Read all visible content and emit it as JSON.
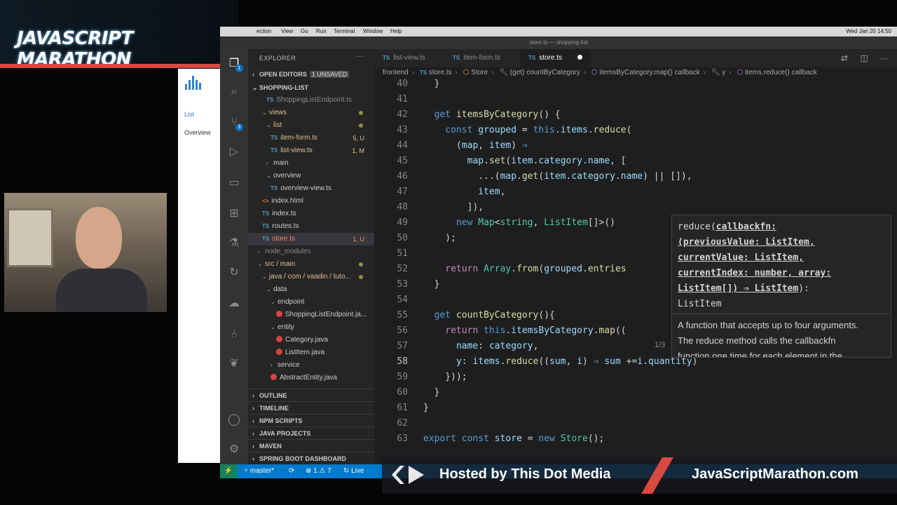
{
  "overlay": {
    "brand_title": "JAVASCRIPT MARATHON",
    "hosted_by": "Hosted by This Dot Media",
    "site_url": "JavaScriptMarathon.com"
  },
  "web_app": {
    "nav": [
      "List",
      "Overview"
    ]
  },
  "menubar": {
    "items": [
      "ection",
      "View",
      "Go",
      "Run",
      "Terminal",
      "Window",
      "Help"
    ],
    "clock": "Wed Jan 20 14:50"
  },
  "window_title": "store.ts — shopping-list",
  "sidebar": {
    "title": "EXPLORER",
    "more": "···",
    "open_editors": "OPEN EDITORS",
    "unsaved_badge": "1 UNSAVED",
    "project": "SHOPPING-LIST",
    "tree": [
      {
        "label": "ShoppingListEndpoint.ts",
        "kind": "ts",
        "status": ""
      },
      {
        "label": "views",
        "kind": "folder",
        "status": ""
      },
      {
        "label": "list",
        "kind": "folder",
        "status": ""
      },
      {
        "label": "item-form.ts",
        "kind": "ts",
        "status": "5, U"
      },
      {
        "label": "list-view.ts",
        "kind": "ts",
        "status": "1, M"
      },
      {
        "label": "main",
        "kind": "folder-closed",
        "status": ""
      },
      {
        "label": "overview",
        "kind": "folder",
        "status": ""
      },
      {
        "label": "overview-view.ts",
        "kind": "ts",
        "status": ""
      },
      {
        "label": "index.html",
        "kind": "html",
        "status": ""
      },
      {
        "label": "index.ts",
        "kind": "ts",
        "status": ""
      },
      {
        "label": "routes.ts",
        "kind": "ts",
        "status": ""
      },
      {
        "label": "store.ts",
        "kind": "ts",
        "status": "1, U"
      },
      {
        "label": "node_modules",
        "kind": "folder-closed",
        "status": ""
      },
      {
        "label": "src / main",
        "kind": "folder",
        "status": ""
      },
      {
        "label": "java / com / vaadin / tuto...",
        "kind": "folder",
        "status": ""
      },
      {
        "label": "data",
        "kind": "folder",
        "status": ""
      },
      {
        "label": "endpoint",
        "kind": "folder",
        "status": ""
      },
      {
        "label": "ShoppingListEndpoint.ja...",
        "kind": "java",
        "status": ""
      },
      {
        "label": "entity",
        "kind": "folder",
        "status": ""
      },
      {
        "label": "Category.java",
        "kind": "java",
        "status": ""
      },
      {
        "label": "ListItem.java",
        "kind": "java",
        "status": ""
      },
      {
        "label": "service",
        "kind": "folder-closed",
        "status": ""
      },
      {
        "label": "AbstractEntity.java",
        "kind": "java",
        "status": ""
      }
    ],
    "sections": [
      "OUTLINE",
      "TIMELINE",
      "NPM SCRIPTS",
      "JAVA PROJECTS",
      "MAVEN",
      "SPRING BOOT DASHBOARD"
    ]
  },
  "tabs": [
    {
      "label": "list-view.ts",
      "active": false
    },
    {
      "label": "item-form.ts",
      "active": false
    },
    {
      "label": "store.ts",
      "active": true
    }
  ],
  "breadcrumb": [
    "frontend",
    "store.ts",
    "Store",
    "(get) countByCategory",
    "itemsByCategory.map() callback",
    "y",
    "items.reduce() callback"
  ],
  "editor": {
    "line_numbers": [
      "40",
      "41",
      "42",
      "43",
      "44",
      "45",
      "46",
      "47",
      "48",
      "49",
      "50",
      "51",
      "52",
      "53",
      "54",
      "55",
      "56",
      "57",
      "58",
      "59",
      "60",
      "61",
      "62",
      "63"
    ],
    "current_line": "58"
  },
  "hover": {
    "signature_lines": [
      "reduce(callbackfn:",
      "(previousValue: ListItem,",
      "currentValue: ListItem,",
      "currentIndex: number, array:",
      "ListItem[]) ⇒ ListItem):",
      "ListItem"
    ],
    "doc_lines": [
      "A function that accepts up to four arguments.",
      "The reduce method calls the callbackfn",
      "function one time for each element in the"
    ],
    "overload": "1/3"
  },
  "statusbar": {
    "branch": "master*",
    "problems": "⊗ 1 ⚠ 7",
    "live": "Live"
  },
  "colors": {
    "statusbar": "#007acc",
    "accent_red": "#d8493f",
    "keyword": "#569cd6",
    "function": "#dcdcaa",
    "variable": "#9cdcfe",
    "type": "#4ec9b0"
  }
}
